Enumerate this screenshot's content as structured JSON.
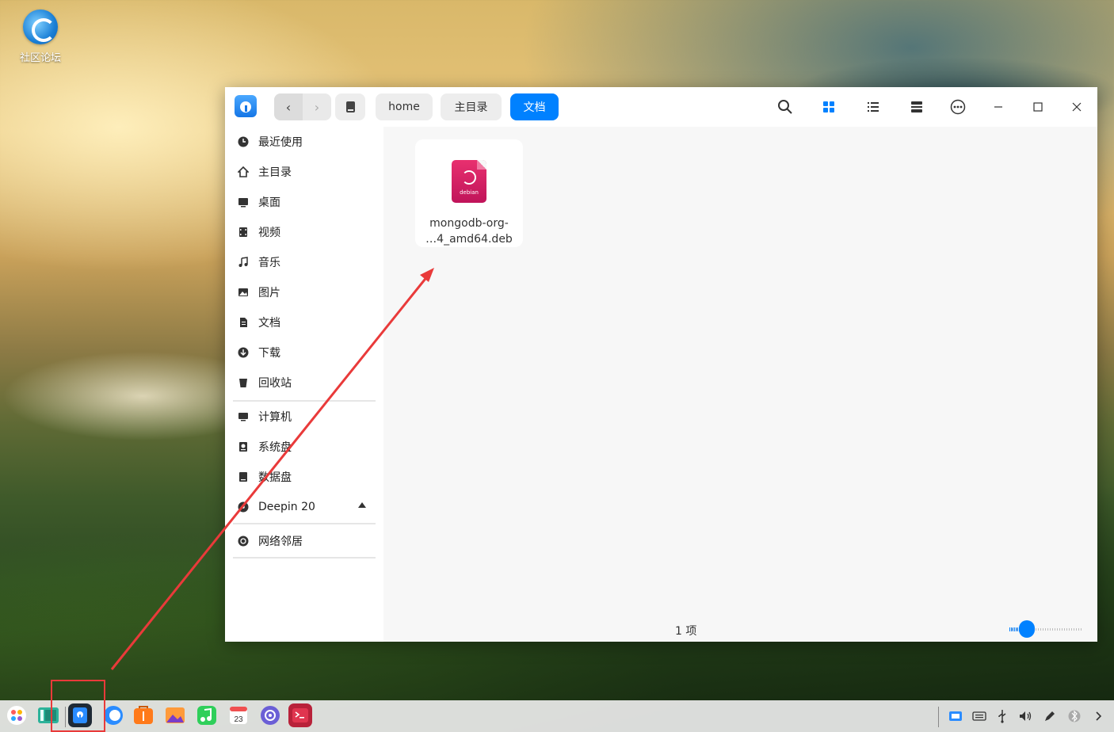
{
  "desktop": {
    "icon_label": "社区论坛"
  },
  "window": {
    "nav": {
      "back": "‹",
      "forward": "›"
    },
    "breadcrumbs": [
      "home",
      "主目录",
      "文档"
    ],
    "sidebar": {
      "items": [
        "最近使用",
        "主目录",
        "桌面",
        "视频",
        "音乐",
        "图片",
        "文档",
        "下载",
        "回收站"
      ],
      "devices": [
        "计算机",
        "系统盘",
        "数据盘",
        "Deepin 20"
      ],
      "network": [
        "网络邻居"
      ]
    },
    "files": [
      {
        "name_line1": "mongodb-org-",
        "name_line2": "…4_amd64.deb",
        "icon_text": "debian"
      }
    ],
    "status_text": "1 项",
    "icon_size_level": 0.3
  },
  "colors": {
    "accent": "#0081ff",
    "debian": "#d70a53",
    "annotation": "#e93a3a"
  },
  "calendar_day": "23"
}
